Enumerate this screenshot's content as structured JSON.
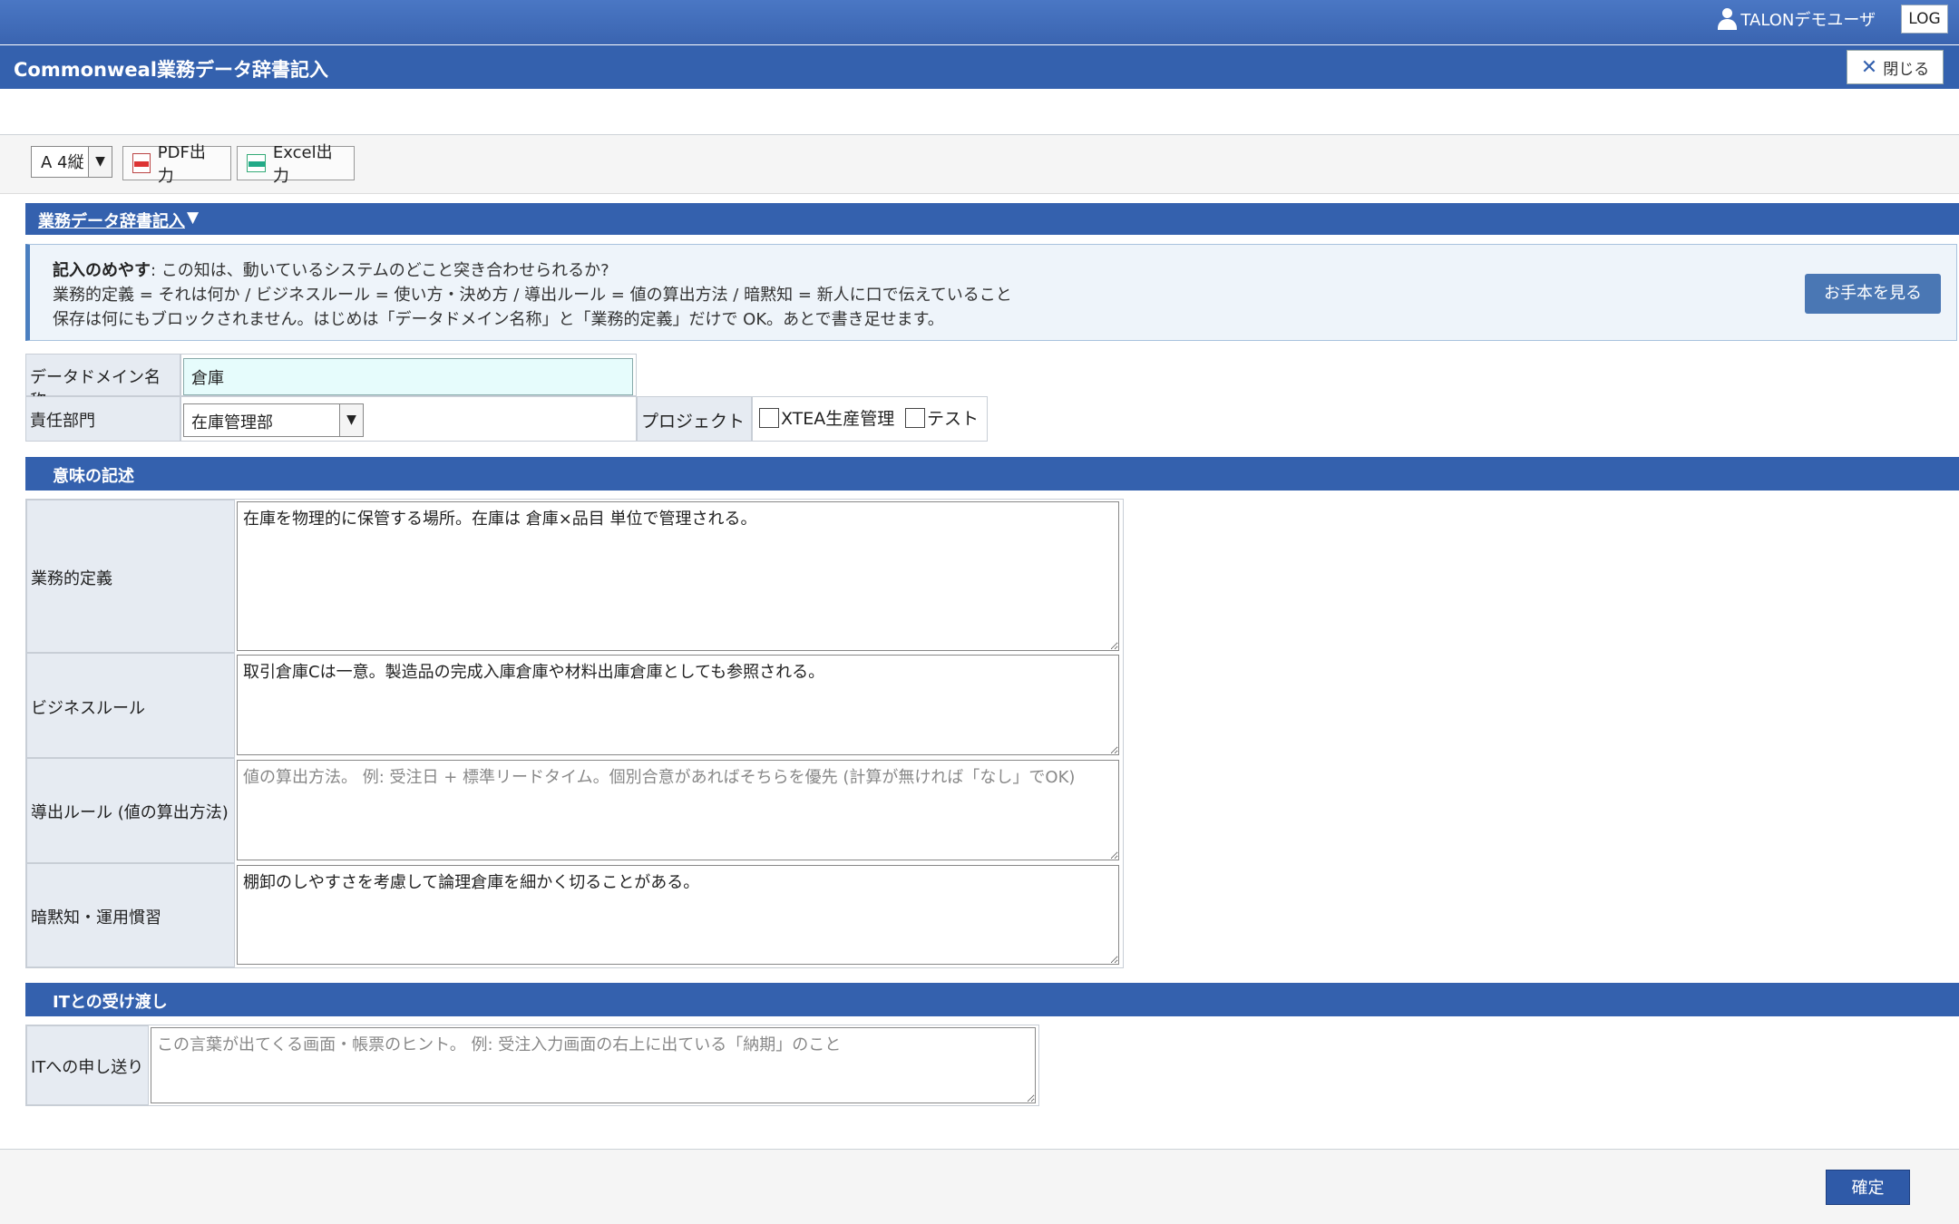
{
  "header": {
    "user_name": "TALONデモユーザ",
    "logout_label": "LOG",
    "title": "Commonweal業務データ辞書記入",
    "close_label": "閉じる"
  },
  "toolbar": {
    "paper_size": "A 4縦",
    "pdf_label": "PDF出力",
    "excel_label": "Excel出力"
  },
  "section1": {
    "title": "業務データ辞書記入",
    "guide_heading": "記入のめやす",
    "guide_line1": ": この知は、動いているシステムのどこと突き合わせられるか?",
    "guide_line2": "業務的定義 = それは何か / ビジネスルール = 使い方・決め方 / 導出ルール = 値の算出方法 / 暗黙知 = 新人に口で伝えていること",
    "guide_line3": "保存は何にもブロックされません。はじめは「データドメイン名称」と「業務的定義」だけで OK。あとで書き足せます。",
    "sample_button": "お手本を見る"
  },
  "form": {
    "domain_label": "データドメイン名称",
    "domain_value": "倉庫",
    "dept_label": "責任部門",
    "dept_value": "在庫管理部",
    "project_label": "プロジェクト",
    "projects": [
      "XTEA生産管理",
      "テスト"
    ]
  },
  "meaning": {
    "title": "意味の記述",
    "definition_label": "業務的定義",
    "definition_value": "在庫を物理的に保管する場所。在庫は 倉庫×品目 単位で管理される。",
    "business_rule_label": "ビジネスルール",
    "business_rule_value": "取引倉庫Cは一意。製造品の完成入庫倉庫や材料出庫倉庫としても参照される。",
    "derivation_label": "導出ルール (値の算出方法)",
    "derivation_placeholder": "値の算出方法。 例: 受注日 + 標準リードタイム。個別合意があればそちらを優先 (計算が無ければ「なし」でOK)",
    "tacit_label": "暗黙知・運用慣習",
    "tacit_value": "棚卸のしやすさを考慮して論理倉庫を細かく切ることがある。"
  },
  "it_handoff": {
    "title": "ITとの受け渡し",
    "note_label": "ITへの申し送り",
    "note_placeholder": "この言葉が出てくる画面・帳票のヒント。 例: 受注入力画面の右上に出ている「納期」のこと"
  },
  "footer": {
    "confirm_label": "確定"
  }
}
